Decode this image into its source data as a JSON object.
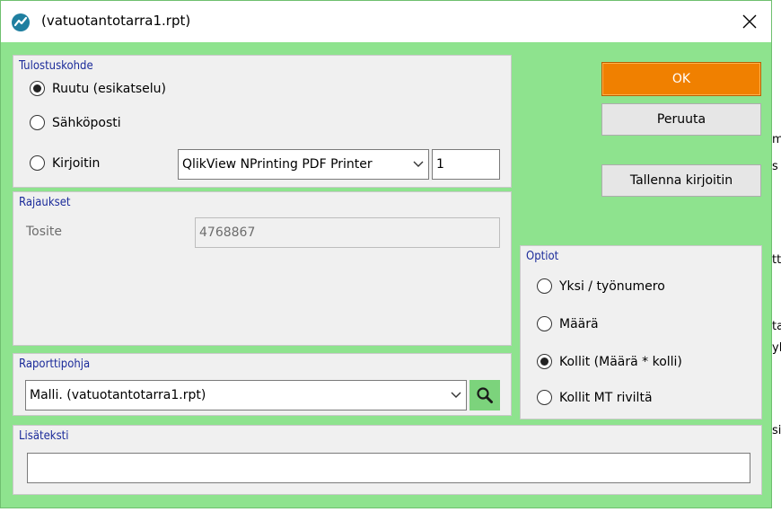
{
  "window": {
    "title": "(vatuotantotarra1.rpt)",
    "close_glyph": "✕"
  },
  "tulostuskohde": {
    "legend": "Tulostuskohde",
    "options": [
      {
        "label": "Ruutu (esikatselu)",
        "selected": true
      },
      {
        "label": "Sähköposti",
        "selected": false
      },
      {
        "label": "Kirjoitin",
        "selected": false
      }
    ],
    "printer": "QlikView NPrinting PDF Printer",
    "copies": "1"
  },
  "rajaukset": {
    "legend": "Rajaukset",
    "tosite_label": "Tosite",
    "tosite_value": "4768867"
  },
  "raporttipohja": {
    "legend": "Raporttipohja",
    "value": "Malli. (vatuotantotarra1.rpt)"
  },
  "lisateksti": {
    "legend": "Lisäteksti",
    "value": ""
  },
  "optiot": {
    "legend": "Optiot",
    "options": [
      {
        "label": "Yksi / työnumero",
        "selected": false
      },
      {
        "label": "Määrä",
        "selected": false
      },
      {
        "label": "Kollit (Määrä * kolli)",
        "selected": true
      },
      {
        "label": "Kollit MT riviltä",
        "selected": false
      }
    ]
  },
  "buttons": {
    "ok": "OK",
    "cancel": "Peruuta",
    "save_printer": "Tallenna kirjoitin"
  },
  "background_fragments": [
    "m",
    "s",
    "tt",
    "ta",
    "yl",
    "si"
  ],
  "colors": {
    "dialog_bg": "#8ee38e",
    "group_bg": "#f0f0f0",
    "legend_text": "#1b2b9a",
    "ok_button": "#f08000",
    "search_button": "#7cd37c",
    "app_icon": "#1f7fa0"
  }
}
